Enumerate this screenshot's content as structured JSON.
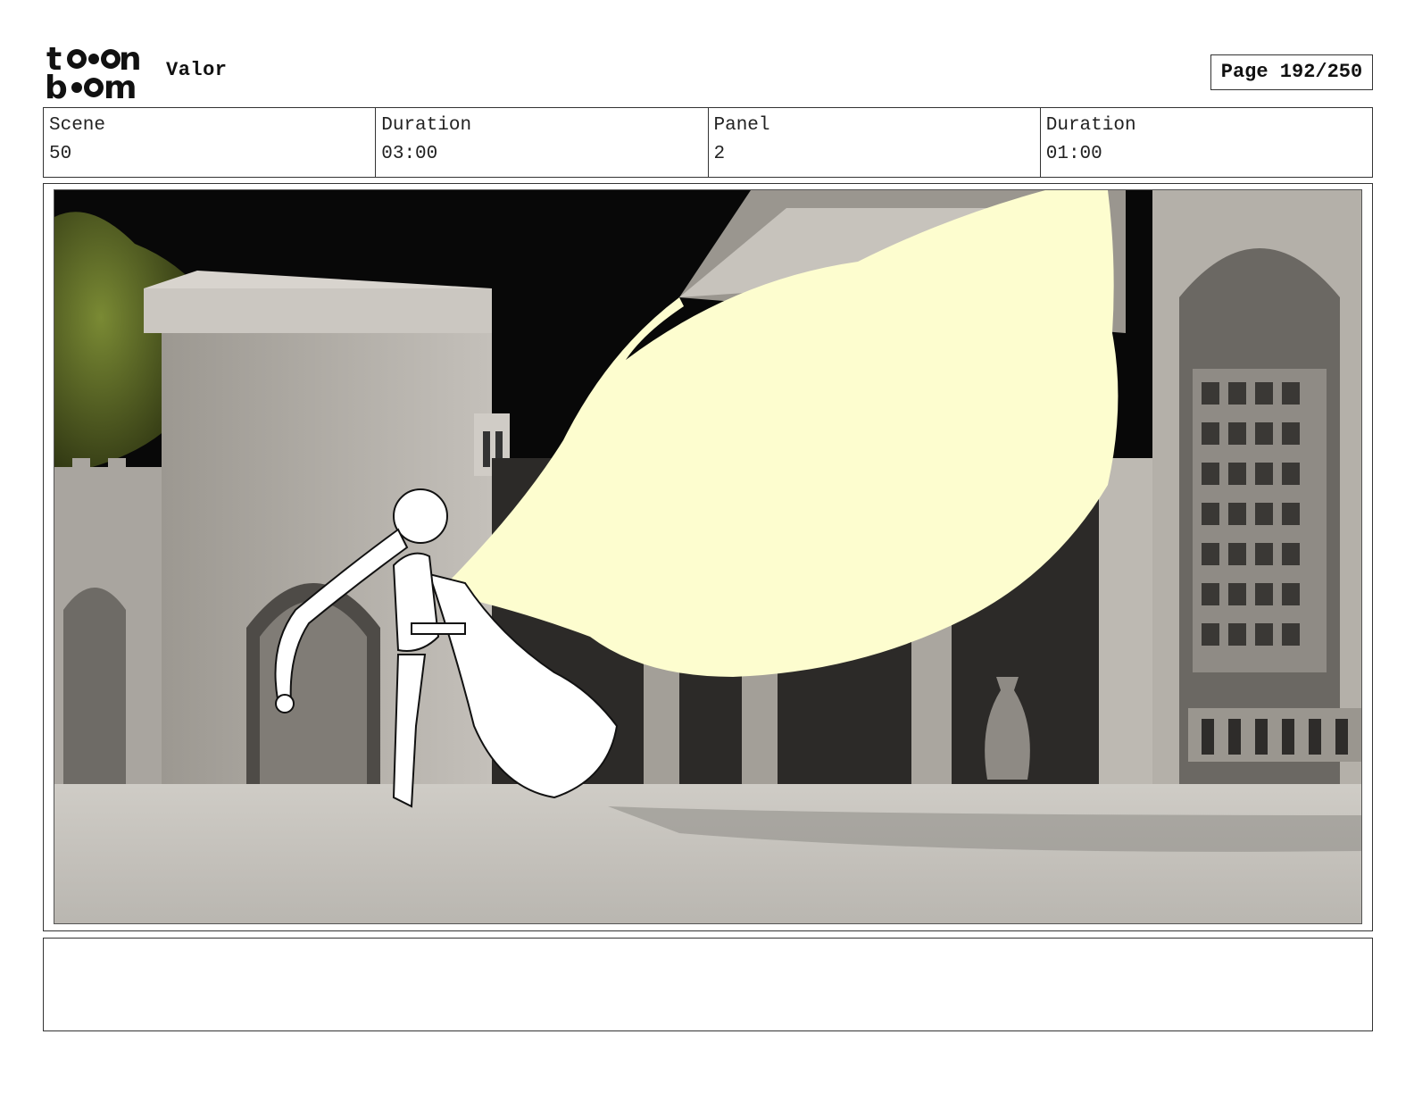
{
  "header": {
    "project_title": "Valor",
    "page_label": "Page 192/250",
    "logo_icon": "toon-boom-logo"
  },
  "info": {
    "scene_label": "Scene",
    "scene_value": "50",
    "scene_duration_label": "Duration",
    "scene_duration_value": "03:00",
    "panel_label": "Panel",
    "panel_value": "2",
    "panel_duration_label": "Duration",
    "panel_duration_value": "01:00"
  },
  "panel": {
    "image_icon": "storyboard-drawing-girl-cape-courtyard",
    "colors": {
      "sky": "#080808",
      "foliage": "#5e6a2a",
      "stone": "#b8b4ae",
      "stone_shadow": "#5a5753",
      "floor": "#c6c3be",
      "cape_glow": "#fdfdcf"
    }
  },
  "notes": {
    "text": ""
  }
}
